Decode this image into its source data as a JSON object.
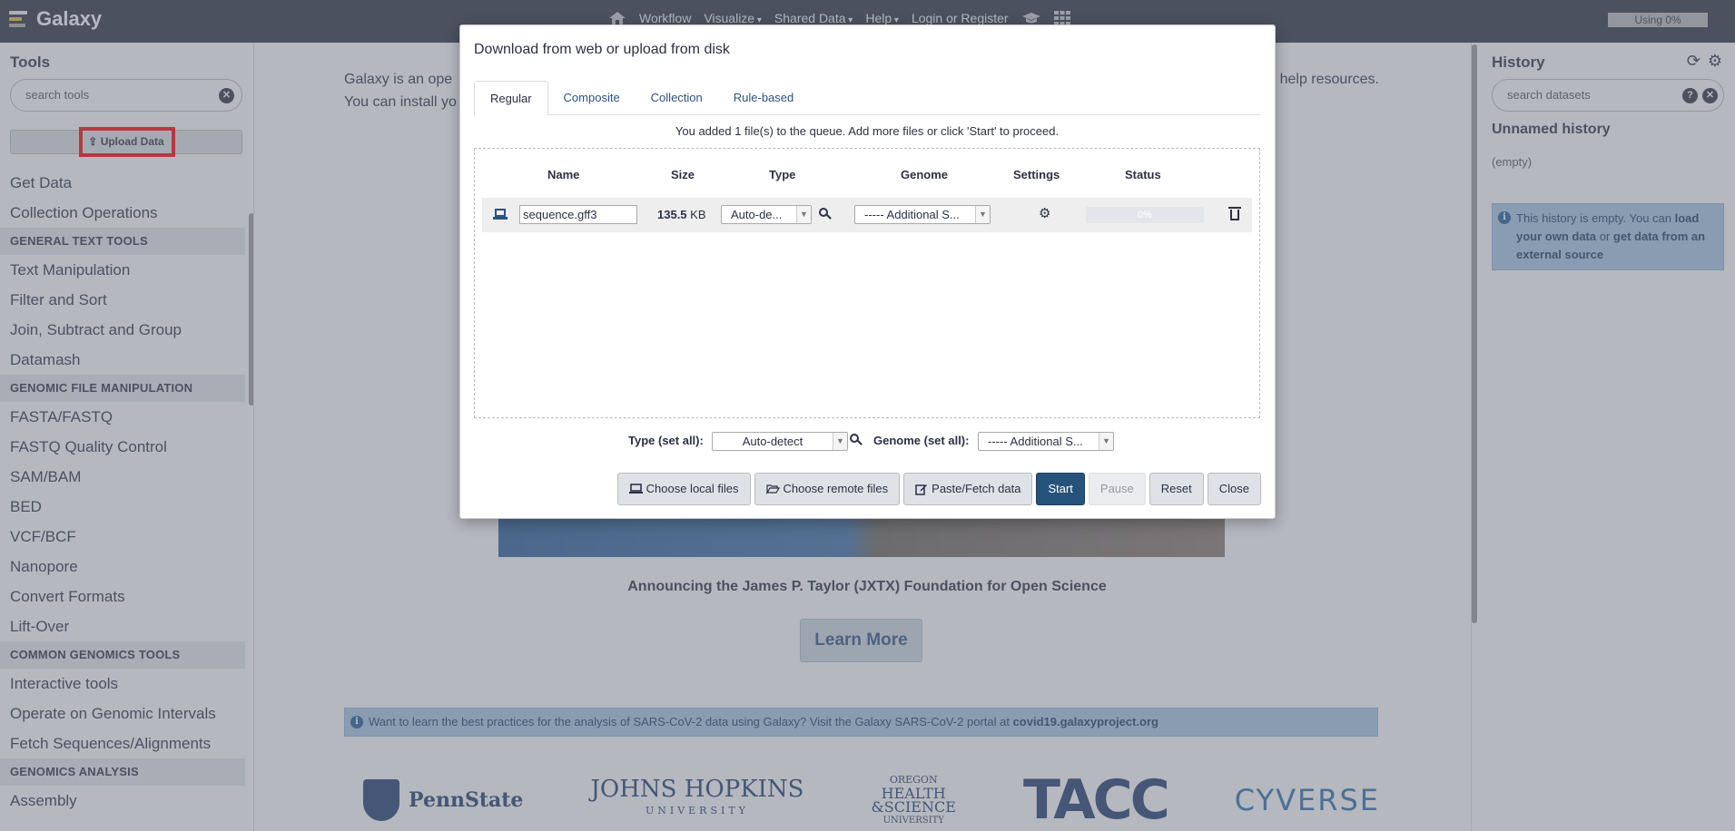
{
  "masthead": {
    "title": "Galaxy",
    "nav": [
      "Workflow",
      "Visualize",
      "Shared Data",
      "Help",
      "Login or Register"
    ],
    "quota": "Using 0%"
  },
  "tools_panel": {
    "title": "Tools",
    "search_placeholder": "search tools",
    "upload_label": "Upload Data",
    "items": [
      {
        "type": "item",
        "label": "Get Data"
      },
      {
        "type": "item",
        "label": "Collection Operations"
      },
      {
        "type": "section",
        "label": "GENERAL TEXT TOOLS"
      },
      {
        "type": "item",
        "label": "Text Manipulation"
      },
      {
        "type": "item",
        "label": "Filter and Sort"
      },
      {
        "type": "item",
        "label": "Join, Subtract and Group"
      },
      {
        "type": "item",
        "label": "Datamash"
      },
      {
        "type": "section",
        "label": "GENOMIC FILE MANIPULATION"
      },
      {
        "type": "item",
        "label": "FASTA/FASTQ"
      },
      {
        "type": "item",
        "label": "FASTQ Quality Control"
      },
      {
        "type": "item",
        "label": "SAM/BAM"
      },
      {
        "type": "item",
        "label": "BED"
      },
      {
        "type": "item",
        "label": "VCF/BCF"
      },
      {
        "type": "item",
        "label": "Nanopore"
      },
      {
        "type": "item",
        "label": "Convert Formats"
      },
      {
        "type": "item",
        "label": "Lift-Over"
      },
      {
        "type": "section",
        "label": "COMMON GENOMICS TOOLS"
      },
      {
        "type": "item",
        "label": "Interactive tools"
      },
      {
        "type": "item",
        "label": "Operate on Genomic Intervals"
      },
      {
        "type": "item",
        "label": "Fetch Sequences/Alignments"
      },
      {
        "type": "section",
        "label": "GENOMICS ANALYSIS"
      },
      {
        "type": "item",
        "label": "Assembly"
      }
    ]
  },
  "center": {
    "intro_line1_start": "Galaxy is an ope",
    "intro_line1_end": "help resources.",
    "intro_line2_start": "You can install yo",
    "announcement": "Announcing the James P. Taylor (JXTX) Foundation for Open Science",
    "learn_more": "Learn More",
    "covid_text": "Want to learn the best practices for the analysis of SARS-CoV-2 data using Galaxy? Visit the Galaxy SARS-CoV-2 portal at ",
    "covid_link": "covid19.galaxyproject.org",
    "logos": [
      "PennState",
      "JOHNS HOPKINS",
      "UNIVERSITY",
      "OREGON",
      "HEALTH",
      "&SCIENCE",
      "UNIVERSITY",
      "TACC",
      "CYVERSE"
    ]
  },
  "history_panel": {
    "title": "History",
    "search_placeholder": "search datasets",
    "history_name": "Unnamed history",
    "size": "(empty)",
    "empty_text_1": "This history is empty. You can ",
    "empty_link_1": "load your own data",
    "empty_text_2": " or ",
    "empty_link_2": "get data from an external source"
  },
  "upload_dialog": {
    "title": "Download from web or upload from disk",
    "tabs": [
      "Regular",
      "Composite",
      "Collection",
      "Rule-based"
    ],
    "active_tab": "Regular",
    "queue_message": "You added 1 file(s) to the queue. Add more files or click 'Start' to proceed.",
    "columns": [
      "Name",
      "Size",
      "Type",
      "Genome",
      "Settings",
      "Status"
    ],
    "file": {
      "name": "sequence.gff3",
      "size_value": "135.5",
      "size_unit": "KB",
      "type": "Auto-de...",
      "genome": "----- Additional S...",
      "status": "0%"
    },
    "type_set_all_label": "Type (set all):",
    "type_set_all_value": "Auto-detect",
    "genome_set_all_label": "Genome (set all):",
    "genome_set_all_value": "----- Additional S...",
    "buttons": {
      "choose_local": "Choose local files",
      "choose_remote": "Choose remote files",
      "paste_fetch": "Paste/Fetch data",
      "start": "Start",
      "pause": "Pause",
      "reset": "Reset",
      "close": "Close"
    }
  },
  "colors": {
    "masthead": "#2c3143",
    "primary_button": "#25537b",
    "highlight": "#ff0000",
    "info_alert": "#a8c7e5"
  }
}
